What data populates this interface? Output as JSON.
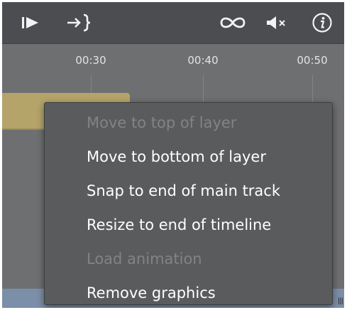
{
  "toolbar": {
    "icons": [
      {
        "name": "play-from-start-icon",
        "glyph": "▶"
      },
      {
        "name": "snap-to-end-icon",
        "glyph": "→}"
      },
      {
        "name": "loop-icon",
        "glyph": "∞"
      },
      {
        "name": "mute-icon",
        "glyph": "◀×"
      },
      {
        "name": "info-icon",
        "glyph": "i"
      }
    ]
  },
  "ruler": {
    "ticks": [
      "00:30",
      "00:40",
      "00:50"
    ]
  },
  "context_menu": {
    "items": [
      {
        "label": "Move to top of layer",
        "enabled": false
      },
      {
        "label": "Move to bottom of layer",
        "enabled": true
      },
      {
        "label": "Snap to end of main track",
        "enabled": true
      },
      {
        "label": "Resize to end of timeline",
        "enabled": true
      },
      {
        "label": "Load animation",
        "enabled": false
      },
      {
        "label": "Remove graphics",
        "enabled": true
      }
    ]
  },
  "colors": {
    "toolbar_bg": "#4b4d50",
    "timeline_bg": "#6e6f71",
    "menu_bg": "#5a5b5d",
    "clip": "#b4a46a",
    "track_strip": "#7c8fa8",
    "disabled_text": "#828385"
  }
}
